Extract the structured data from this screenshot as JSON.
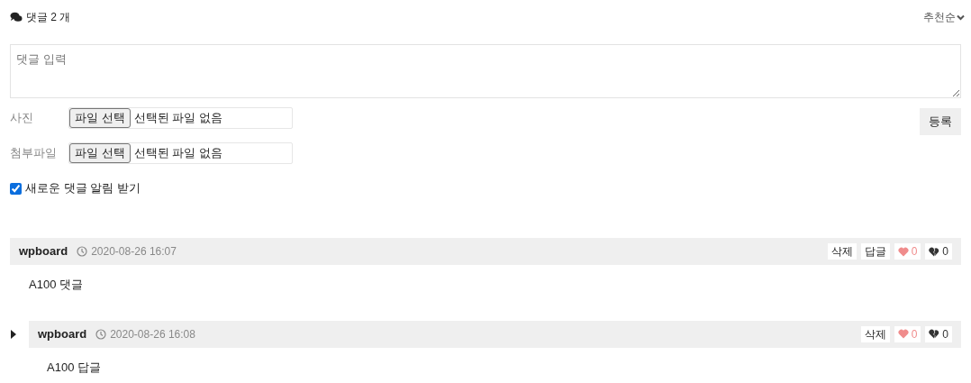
{
  "header": {
    "count_label": "댓글 2 개",
    "sort": "추천순"
  },
  "form": {
    "placeholder": "댓글 입력",
    "submit": "등록",
    "files": [
      {
        "label": "사진",
        "button": "파일 선택",
        "status": "선택된 파일 없음"
      },
      {
        "label": "첨부파일",
        "button": "파일 선택",
        "status": "선택된 파일 없음"
      }
    ],
    "notify": {
      "label": "새로운 댓글 알림 받기",
      "checked": true
    }
  },
  "comments": [
    {
      "author": "wpboard",
      "date": "2020-08-26 16:07",
      "delete": "삭제",
      "reply": "답글",
      "likes": "0",
      "dislikes": "0",
      "body": "A100 댓글",
      "children": [
        {
          "author": "wpboard",
          "date": "2020-08-26 16:08",
          "delete": "삭제",
          "likes": "0",
          "dislikes": "0",
          "body": "A100 답글"
        }
      ]
    }
  ]
}
